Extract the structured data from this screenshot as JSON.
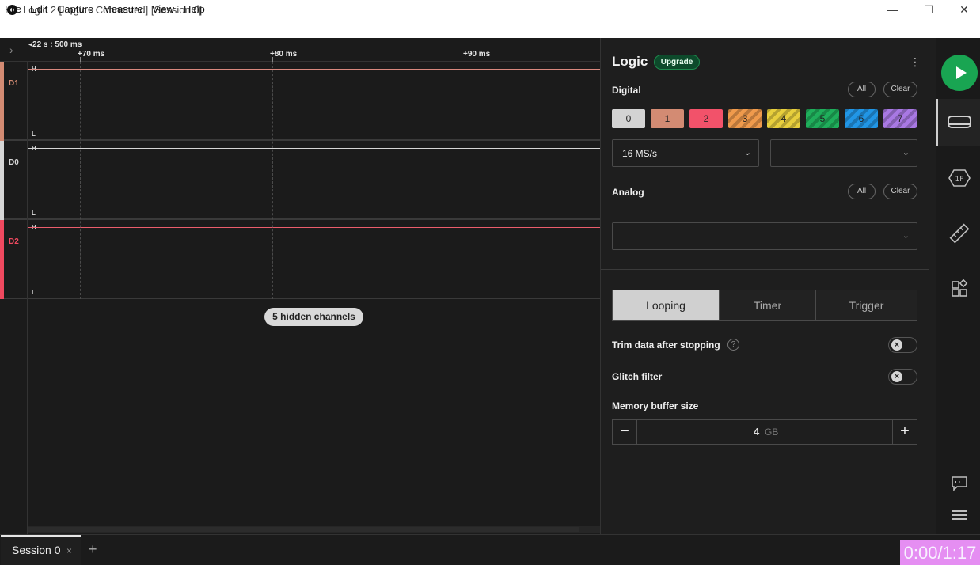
{
  "window": {
    "title": "Logic 2 [Logic - Connected] [Session 0]",
    "minimize": "—",
    "maximize": "☐",
    "close": "✕"
  },
  "menu": [
    "File",
    "Edit",
    "Capture",
    "Measure",
    "View",
    "Help"
  ],
  "timeline": {
    "origin": "22 s : 500 ms",
    "ticks": [
      "+70 ms",
      "+80 ms",
      "+90 ms"
    ]
  },
  "channels": [
    {
      "name": "D1",
      "color": "#d38b73",
      "high": "H",
      "low": "L"
    },
    {
      "name": "D0",
      "color": "#d6d6d6",
      "high": "H",
      "low": "L"
    },
    {
      "name": "D2",
      "color": "#f0495f",
      "high": "H",
      "low": "L"
    }
  ],
  "hidden_channels": "5 hidden channels",
  "panel": {
    "title": "Logic",
    "upgrade": "Upgrade",
    "digital": {
      "label": "Digital",
      "all": "All",
      "clear": "Clear",
      "channels": [
        {
          "label": "0",
          "color": "#d3d3d3",
          "striped": false
        },
        {
          "label": "1",
          "color": "#d38b73",
          "striped": false
        },
        {
          "label": "2",
          "color": "#f2526a",
          "striped": false
        },
        {
          "label": "3",
          "color": "#ef9a4c",
          "striped": true
        },
        {
          "label": "4",
          "color": "#e8cf3d",
          "striped": true
        },
        {
          "label": "5",
          "color": "#1fae5b",
          "striped": true
        },
        {
          "label": "6",
          "color": "#2196e6",
          "striped": true
        },
        {
          "label": "7",
          "color": "#a878e3",
          "striped": true
        }
      ],
      "sample_rate": "16 MS/s",
      "voltage": ""
    },
    "analog": {
      "label": "Analog",
      "all": "All",
      "clear": "Clear",
      "sample_rate": ""
    },
    "modes": [
      "Looping",
      "Timer",
      "Trigger"
    ],
    "active_mode": "Looping",
    "trim_label": "Trim data after stopping",
    "glitch_label": "Glitch filter",
    "memory_label": "Memory buffer size",
    "memory_value": "4",
    "memory_unit": "GB"
  },
  "rail": {
    "icons": [
      "device-icon",
      "analyzer-icon",
      "measure-icon",
      "extensions-icon",
      "notes-icon",
      "menu-icon"
    ]
  },
  "tabs": {
    "session": "Session 0",
    "close": "×",
    "add": "+"
  },
  "video_time": "0:00/1:17"
}
